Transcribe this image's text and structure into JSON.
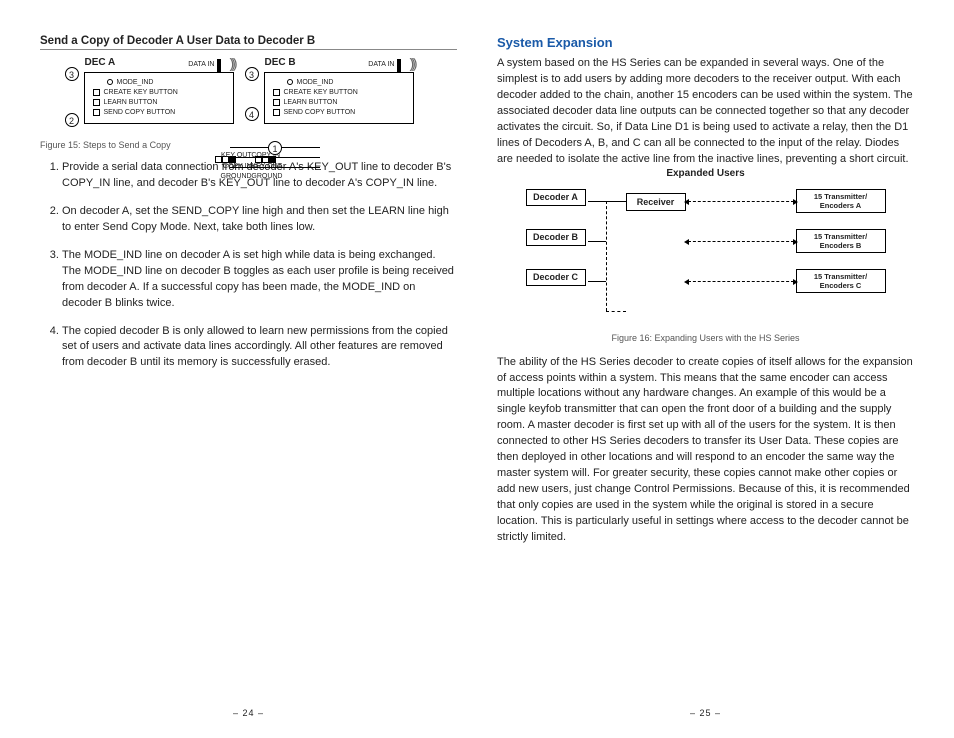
{
  "left": {
    "title": "Send a Copy of Decoder A User Data to Decoder B",
    "fig15": {
      "decA": "DEC A",
      "decB": "DEC B",
      "datain": "DATA IN",
      "modeind": "MODE_IND",
      "btn_create": "CREATE KEY BUTTON",
      "btn_learn": "LEARN BUTTON",
      "btn_send": "SEND COPY BUTTON",
      "ioA": [
        "COPY IN",
        "KEY OUT",
        "GROUND"
      ],
      "ioB": [
        "KEY OUT",
        "COPY IN",
        "GROUND"
      ],
      "nums": {
        "n1": "1",
        "n2": "2",
        "n3a": "3",
        "n3b": "3",
        "n4": "4"
      }
    },
    "caption15": "Figure 15: Steps to Send a Copy",
    "steps": [
      "Provide a serial data connection from decoder A's KEY_OUT line to decoder B's COPY_IN line, and decoder B's KEY_OUT line to decoder A's COPY_IN line.",
      "On decoder A, set the SEND_COPY line high and then set the LEARN line high to enter Send Copy Mode. Next, take both lines low.",
      "The MODE_IND line on decoder A is set high while data is being exchanged. The MODE_IND line on decoder B toggles as each user profile is being received from decoder A. If a successful copy has been made, the MODE_IND on decoder B blinks twice.",
      "The copied decoder B is only allowed to learn new permissions from the copied set of users and activate data lines accordingly. All other features are removed from decoder B until its memory is successfully erased."
    ],
    "pagenum": "– 24 –"
  },
  "right": {
    "title": "System Expansion",
    "para1": "A system based on the HS Series can be expanded in several ways. One of the simplest is to add users by adding more decoders to the receiver output. With each decoder added to the chain, another 15 encoders can be used within the system. The associated decoder data line outputs can be connected together so that any decoder activates the circuit. So, if Data Line D1 is being used to activate a relay, then the D1 lines of Decoders A, B, and C can all be connected to the input of the relay. Diodes are needed to isolate the active line from the inactive lines, preventing a short circuit.",
    "expanded_label": "Expanded Users",
    "fig16": {
      "decoderA": "Decoder A",
      "decoderB": "Decoder B",
      "decoderC": "Decoder C",
      "receiver": "Receiver",
      "txA": "15 Transmitter/ Encoders A",
      "txB": "15 Transmitter/ Encoders B",
      "txC": "15 Transmitter/ Encoders C"
    },
    "caption16": "Figure 16: Expanding Users with the HS Series",
    "para2": "The ability of the HS Series decoder to create copies of itself allows for the expansion of access points within a system. This means that the same encoder can access multiple locations without any hardware changes. An example of this would be a single keyfob transmitter that can open the front door of a building and the supply room. A master decoder is first set up with all of the users for the system. It is then connected to other HS Series decoders to transfer its User Data. These copies are then deployed in other locations and will respond to an encoder the same way the master system will. For greater security, these copies cannot make other copies or add new users, just change Control Permissions. Because of this, it is recommended that only copies are used in the system while the original is stored in a secure location. This is particularly useful in settings where access to the decoder cannot be strictly limited.",
    "pagenum": "– 25 –"
  }
}
